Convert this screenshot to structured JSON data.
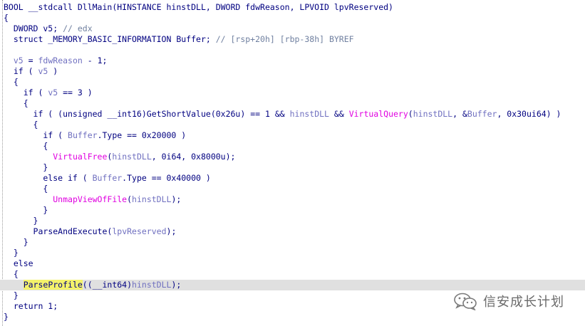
{
  "code_lines": [
    [
      {
        "t": "BOOL __stdcall DllMain(HINSTANCE hinstDLL, DWORD fdwReason, LPVOID lpvReserved)",
        "c": "k"
      }
    ],
    [
      {
        "t": "{",
        "c": "k"
      }
    ],
    [
      {
        "t": "  DWORD v5; ",
        "c": "k"
      },
      {
        "t": "// edx",
        "c": "c"
      }
    ],
    [
      {
        "t": "  struct _MEMORY_BASIC_INFORMATION Buffer; ",
        "c": "k"
      },
      {
        "t": "// [rsp+20h] [rbp-38h] BYREF",
        "c": "c"
      }
    ],
    [],
    [
      {
        "t": "  ",
        "c": "k"
      },
      {
        "t": "v5",
        "c": "v"
      },
      {
        "t": " = ",
        "c": "k"
      },
      {
        "t": "fdwReason",
        "c": "v"
      },
      {
        "t": " - 1;",
        "c": "k"
      }
    ],
    [
      {
        "t": "  if ( ",
        "c": "k"
      },
      {
        "t": "v5",
        "c": "v"
      },
      {
        "t": " )",
        "c": "k"
      }
    ],
    [
      {
        "t": "  {",
        "c": "k"
      }
    ],
    [
      {
        "t": "    if ( ",
        "c": "k"
      },
      {
        "t": "v5",
        "c": "v"
      },
      {
        "t": " == 3 )",
        "c": "k"
      }
    ],
    [
      {
        "t": "    {",
        "c": "k"
      }
    ],
    [
      {
        "t": "      if ( (unsigned __int16)",
        "c": "k"
      },
      {
        "t": "GetShortValue",
        "c": "p"
      },
      {
        "t": "(0x26u) == 1 && ",
        "c": "k"
      },
      {
        "t": "hinstDLL",
        "c": "v"
      },
      {
        "t": " && ",
        "c": "k"
      },
      {
        "t": "VirtualQuery",
        "c": "f"
      },
      {
        "t": "(",
        "c": "k"
      },
      {
        "t": "hinstDLL",
        "c": "v"
      },
      {
        "t": ", &",
        "c": "k"
      },
      {
        "t": "Buffer",
        "c": "v"
      },
      {
        "t": ", 0x30ui64) )",
        "c": "k"
      }
    ],
    [
      {
        "t": "      {",
        "c": "k"
      }
    ],
    [
      {
        "t": "        if ( ",
        "c": "k"
      },
      {
        "t": "Buffer",
        "c": "v"
      },
      {
        "t": ".Type == 0x20000 )",
        "c": "k"
      }
    ],
    [
      {
        "t": "        {",
        "c": "k"
      }
    ],
    [
      {
        "t": "          ",
        "c": "k"
      },
      {
        "t": "VirtualFree",
        "c": "f"
      },
      {
        "t": "(",
        "c": "k"
      },
      {
        "t": "hinstDLL",
        "c": "v"
      },
      {
        "t": ", 0i64, 0x8000u);",
        "c": "k"
      }
    ],
    [
      {
        "t": "        }",
        "c": "k"
      }
    ],
    [
      {
        "t": "        else if ( ",
        "c": "k"
      },
      {
        "t": "Buffer",
        "c": "v"
      },
      {
        "t": ".Type == 0x40000 )",
        "c": "k"
      }
    ],
    [
      {
        "t": "        {",
        "c": "k"
      }
    ],
    [
      {
        "t": "          ",
        "c": "k"
      },
      {
        "t": "UnmapViewOfFile",
        "c": "f"
      },
      {
        "t": "(",
        "c": "k"
      },
      {
        "t": "hinstDLL",
        "c": "v"
      },
      {
        "t": ");",
        "c": "k"
      }
    ],
    [
      {
        "t": "        }",
        "c": "k"
      }
    ],
    [
      {
        "t": "      }",
        "c": "k"
      }
    ],
    [
      {
        "t": "      ",
        "c": "k"
      },
      {
        "t": "ParseAndExecute",
        "c": "p"
      },
      {
        "t": "(",
        "c": "k"
      },
      {
        "t": "lpvReserved",
        "c": "v"
      },
      {
        "t": ");",
        "c": "k"
      }
    ],
    [
      {
        "t": "    }",
        "c": "k"
      }
    ],
    [
      {
        "t": "  }",
        "c": "k"
      }
    ],
    [
      {
        "t": "  else",
        "c": "k"
      }
    ],
    [
      {
        "t": "  {",
        "c": "k"
      }
    ],
    [
      {
        "t": "    ",
        "c": "k"
      },
      {
        "t": "ParseProfile",
        "c": "u"
      },
      {
        "t": "((__int64)",
        "c": "k"
      },
      {
        "t": "hinstDLL",
        "c": "v"
      },
      {
        "t": ");",
        "c": "k"
      }
    ],
    [
      {
        "t": "  }",
        "c": "k"
      }
    ],
    [
      {
        "t": "  return 1;",
        "c": "k"
      }
    ],
    [
      {
        "t": "}",
        "c": "k"
      }
    ]
  ],
  "highlighted_line_index": 26,
  "colors": {
    "keyword": "#000080",
    "variable": "#7070c0",
    "comment": "#7080a0",
    "api_function": "#e000e0",
    "highlight_bg": "#e0e0e0",
    "cursor_word_bg": "#f4f26a"
  },
  "watermark": {
    "icon": "wechat-icon",
    "text": "信安成长计划"
  }
}
